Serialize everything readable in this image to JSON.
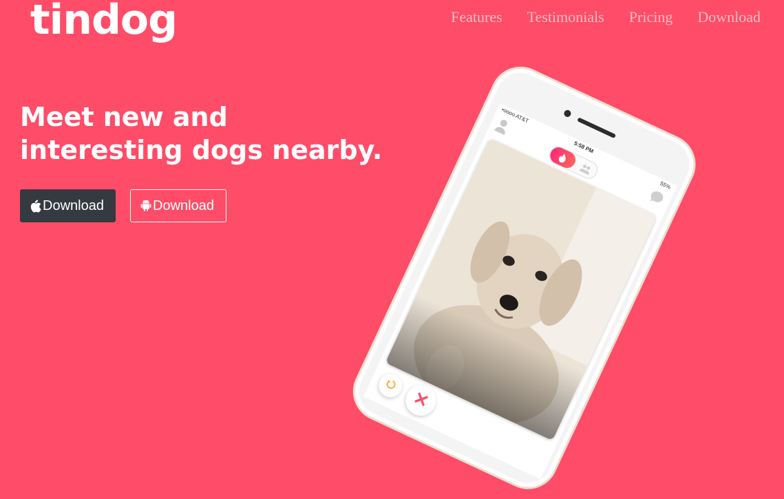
{
  "brand": {
    "name": "tindog"
  },
  "nav": {
    "items": [
      {
        "label": "Features"
      },
      {
        "label": "Testimonials"
      },
      {
        "label": "Pricing"
      },
      {
        "label": "Download"
      }
    ]
  },
  "hero": {
    "headline_line1": "Meet new and",
    "headline_line2": "interesting dogs nearby.",
    "apple_button_label": "Download",
    "android_button_label": "Download"
  },
  "phone": {
    "carrier": "•oooo AT&T",
    "time": "5:58 PM",
    "battery": "55%"
  },
  "colors": {
    "background": "#ff4c68",
    "apple_button": "#343a40",
    "text": "#ffffff"
  },
  "icons": [
    "apple-icon",
    "android-icon",
    "flame-icon",
    "profile-icon",
    "chat-icon",
    "rewind-icon",
    "nope-icon"
  ]
}
